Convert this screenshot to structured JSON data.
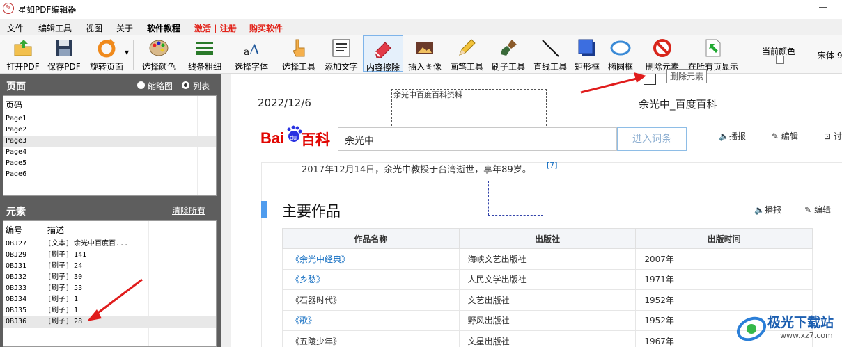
{
  "app": {
    "title": "星如PDF编辑器",
    "icon": "pen-logo-icon"
  },
  "menu": [
    "文件",
    "编辑工具",
    "视图",
    "关于",
    "软件教程",
    "激活 | 注册",
    "购买软件"
  ],
  "toolbar": {
    "buttons": [
      {
        "label": "打开PDF",
        "icon": "open-folder-icon"
      },
      {
        "label": "保存PDF",
        "icon": "floppy-disk-icon"
      },
      {
        "label": "旋转页面",
        "icon": "rotate-icon"
      },
      {
        "label": "选择颜色",
        "icon": "palette-icon"
      },
      {
        "label": "线条粗细",
        "icon": "line-weight-icon"
      },
      {
        "label": "选择字体",
        "icon": "font-icon"
      },
      {
        "label": "选择工具",
        "icon": "pointer-hand-icon"
      },
      {
        "label": "添加文字",
        "icon": "add-text-icon"
      },
      {
        "label": "内容擦除",
        "icon": "eraser-icon"
      },
      {
        "label": "插入图像",
        "icon": "insert-image-icon"
      },
      {
        "label": "画笔工具",
        "icon": "pencil-icon"
      },
      {
        "label": "刷子工具",
        "icon": "brush-icon"
      },
      {
        "label": "直线工具",
        "icon": "line-icon"
      },
      {
        "label": "矩形框",
        "icon": "rectangle-icon"
      },
      {
        "label": "椭圆框",
        "icon": "ellipse-icon"
      },
      {
        "label": "删除元素",
        "icon": "delete-prohibit-icon"
      },
      {
        "label": "在所有页显示",
        "icon": "show-all-pages-icon"
      }
    ],
    "current_color_label": "当前颜色",
    "font_name": "宋体 9",
    "tooltip": "删除元素"
  },
  "pages_panel": {
    "title": "页面",
    "view_options": [
      "缩略图",
      "列表"
    ],
    "selected_view": "列表",
    "column": "页码",
    "items": [
      "Page1",
      "Page2",
      "Page3",
      "Page4",
      "Page5",
      "Page6"
    ],
    "selected": "Page3"
  },
  "elements_panel": {
    "title": "元素",
    "clear_all": "清除所有",
    "columns": [
      "编号",
      "描述"
    ],
    "rows": [
      {
        "id": "OBJ27",
        "desc": "[文本] 余光中百度百..."
      },
      {
        "id": "OBJ29",
        "desc": "[刷子] 141"
      },
      {
        "id": "OBJ31",
        "desc": "[刷子] 24"
      },
      {
        "id": "OBJ32",
        "desc": "[刷子] 30"
      },
      {
        "id": "OBJ33",
        "desc": "[刷子] 53"
      },
      {
        "id": "OBJ34",
        "desc": "[刷子] 1"
      },
      {
        "id": "OBJ35",
        "desc": "[刷子] 1"
      },
      {
        "id": "OBJ36",
        "desc": "[刷子] 28"
      }
    ],
    "selected": "OBJ36"
  },
  "document": {
    "date": "2022/12/6",
    "header_title": "余光中_百度百科",
    "annotation_text": "余光中百度百科资料",
    "baike_logo": "Bai百科",
    "search_value": "余光中",
    "enter_button": "进入词条",
    "top_actions": [
      "播报",
      "编辑",
      "讨"
    ],
    "news_line": "2017年12月14日，余光中教授于台湾逝世，享年89岁。",
    "citation": "[7]",
    "section_title": "主要作品",
    "section_actions": [
      "播报",
      "编辑"
    ],
    "table_headers": [
      "作品名称",
      "出版社",
      "出版时间"
    ],
    "table_rows": [
      [
        "《余光中经典》",
        "海峡文艺出版社",
        "2007年"
      ],
      [
        "《乡愁》",
        "人民文学出版社",
        "1971年"
      ],
      [
        "《石器时代》",
        "文艺出版社",
        "1952年"
      ],
      [
        "《歌》",
        "野风出版社",
        "1952年"
      ],
      [
        "《五陵少年》",
        "文星出版社",
        "1967年"
      ]
    ]
  },
  "watermark": {
    "text": "极光下载站",
    "url": "www.xz7.com"
  },
  "colors": {
    "accent_red": "#e2231a",
    "panel_gray": "#5e5e5e",
    "baidu_blue": "#2932e1",
    "baidu_red": "#e10602",
    "link_blue": "#136ec2"
  }
}
